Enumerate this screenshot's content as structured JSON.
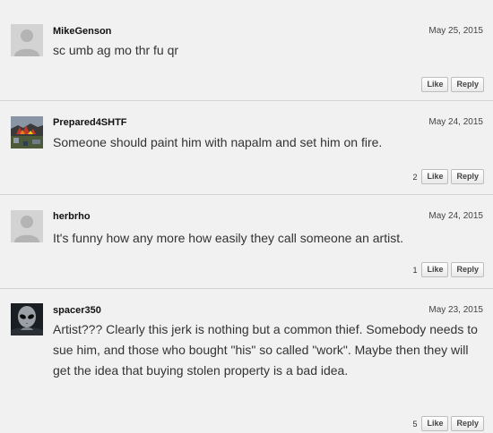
{
  "comments": [
    {
      "username": "MikeGenson",
      "date": "May 25, 2015",
      "text": "sc umb ag mo thr fu qr",
      "likes": "",
      "like_label": "Like",
      "reply_label": "Reply",
      "avatar": "default-user-icon"
    },
    {
      "username": "Prepared4SHTF",
      "date": "May 24, 2015",
      "text": "Someone should paint him with napalm and set him on fire.",
      "likes": "2",
      "like_label": "Like",
      "reply_label": "Reply",
      "avatar": "fire-photo-avatar"
    },
    {
      "username": "herbrho",
      "date": "May 24, 2015",
      "text": "It's funny how any more how easily they call someone an artist.",
      "likes": "1",
      "like_label": "Like",
      "reply_label": "Reply",
      "avatar": "default-user-icon"
    },
    {
      "username": "spacer350",
      "date": "May 23, 2015",
      "text": "Artist??? Clearly this jerk is nothing but a common thief. Somebody needs to sue him, and those who bought \"his\" so called \"work\". Maybe then they will get the idea that buying stolen property is a bad idea.",
      "likes": "5",
      "like_label": "Like",
      "reply_label": "Reply",
      "avatar": "alien-avatar"
    }
  ],
  "colors": {
    "background": "#f1f1f1",
    "divider": "#d4d4d4",
    "text": "#333333"
  }
}
